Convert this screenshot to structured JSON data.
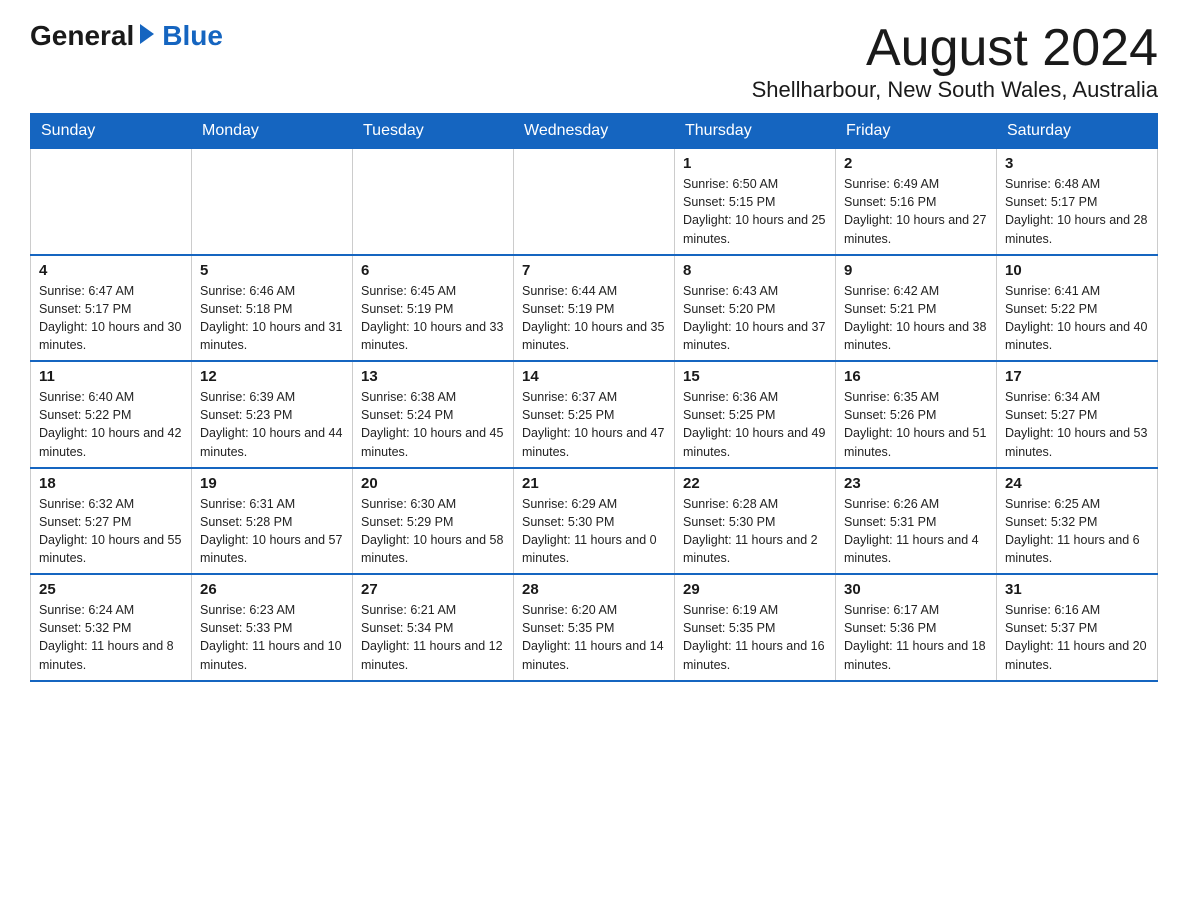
{
  "header": {
    "logo_general": "General",
    "logo_blue": "Blue",
    "month_year": "August 2024",
    "location": "Shellharbour, New South Wales, Australia"
  },
  "days_of_week": [
    "Sunday",
    "Monday",
    "Tuesday",
    "Wednesday",
    "Thursday",
    "Friday",
    "Saturday"
  ],
  "weeks": [
    [
      {
        "day": "",
        "info": ""
      },
      {
        "day": "",
        "info": ""
      },
      {
        "day": "",
        "info": ""
      },
      {
        "day": "",
        "info": ""
      },
      {
        "day": "1",
        "info": "Sunrise: 6:50 AM\nSunset: 5:15 PM\nDaylight: 10 hours and 25 minutes."
      },
      {
        "day": "2",
        "info": "Sunrise: 6:49 AM\nSunset: 5:16 PM\nDaylight: 10 hours and 27 minutes."
      },
      {
        "day": "3",
        "info": "Sunrise: 6:48 AM\nSunset: 5:17 PM\nDaylight: 10 hours and 28 minutes."
      }
    ],
    [
      {
        "day": "4",
        "info": "Sunrise: 6:47 AM\nSunset: 5:17 PM\nDaylight: 10 hours and 30 minutes."
      },
      {
        "day": "5",
        "info": "Sunrise: 6:46 AM\nSunset: 5:18 PM\nDaylight: 10 hours and 31 minutes."
      },
      {
        "day": "6",
        "info": "Sunrise: 6:45 AM\nSunset: 5:19 PM\nDaylight: 10 hours and 33 minutes."
      },
      {
        "day": "7",
        "info": "Sunrise: 6:44 AM\nSunset: 5:19 PM\nDaylight: 10 hours and 35 minutes."
      },
      {
        "day": "8",
        "info": "Sunrise: 6:43 AM\nSunset: 5:20 PM\nDaylight: 10 hours and 37 minutes."
      },
      {
        "day": "9",
        "info": "Sunrise: 6:42 AM\nSunset: 5:21 PM\nDaylight: 10 hours and 38 minutes."
      },
      {
        "day": "10",
        "info": "Sunrise: 6:41 AM\nSunset: 5:22 PM\nDaylight: 10 hours and 40 minutes."
      }
    ],
    [
      {
        "day": "11",
        "info": "Sunrise: 6:40 AM\nSunset: 5:22 PM\nDaylight: 10 hours and 42 minutes."
      },
      {
        "day": "12",
        "info": "Sunrise: 6:39 AM\nSunset: 5:23 PM\nDaylight: 10 hours and 44 minutes."
      },
      {
        "day": "13",
        "info": "Sunrise: 6:38 AM\nSunset: 5:24 PM\nDaylight: 10 hours and 45 minutes."
      },
      {
        "day": "14",
        "info": "Sunrise: 6:37 AM\nSunset: 5:25 PM\nDaylight: 10 hours and 47 minutes."
      },
      {
        "day": "15",
        "info": "Sunrise: 6:36 AM\nSunset: 5:25 PM\nDaylight: 10 hours and 49 minutes."
      },
      {
        "day": "16",
        "info": "Sunrise: 6:35 AM\nSunset: 5:26 PM\nDaylight: 10 hours and 51 minutes."
      },
      {
        "day": "17",
        "info": "Sunrise: 6:34 AM\nSunset: 5:27 PM\nDaylight: 10 hours and 53 minutes."
      }
    ],
    [
      {
        "day": "18",
        "info": "Sunrise: 6:32 AM\nSunset: 5:27 PM\nDaylight: 10 hours and 55 minutes."
      },
      {
        "day": "19",
        "info": "Sunrise: 6:31 AM\nSunset: 5:28 PM\nDaylight: 10 hours and 57 minutes."
      },
      {
        "day": "20",
        "info": "Sunrise: 6:30 AM\nSunset: 5:29 PM\nDaylight: 10 hours and 58 minutes."
      },
      {
        "day": "21",
        "info": "Sunrise: 6:29 AM\nSunset: 5:30 PM\nDaylight: 11 hours and 0 minutes."
      },
      {
        "day": "22",
        "info": "Sunrise: 6:28 AM\nSunset: 5:30 PM\nDaylight: 11 hours and 2 minutes."
      },
      {
        "day": "23",
        "info": "Sunrise: 6:26 AM\nSunset: 5:31 PM\nDaylight: 11 hours and 4 minutes."
      },
      {
        "day": "24",
        "info": "Sunrise: 6:25 AM\nSunset: 5:32 PM\nDaylight: 11 hours and 6 minutes."
      }
    ],
    [
      {
        "day": "25",
        "info": "Sunrise: 6:24 AM\nSunset: 5:32 PM\nDaylight: 11 hours and 8 minutes."
      },
      {
        "day": "26",
        "info": "Sunrise: 6:23 AM\nSunset: 5:33 PM\nDaylight: 11 hours and 10 minutes."
      },
      {
        "day": "27",
        "info": "Sunrise: 6:21 AM\nSunset: 5:34 PM\nDaylight: 11 hours and 12 minutes."
      },
      {
        "day": "28",
        "info": "Sunrise: 6:20 AM\nSunset: 5:35 PM\nDaylight: 11 hours and 14 minutes."
      },
      {
        "day": "29",
        "info": "Sunrise: 6:19 AM\nSunset: 5:35 PM\nDaylight: 11 hours and 16 minutes."
      },
      {
        "day": "30",
        "info": "Sunrise: 6:17 AM\nSunset: 5:36 PM\nDaylight: 11 hours and 18 minutes."
      },
      {
        "day": "31",
        "info": "Sunrise: 6:16 AM\nSunset: 5:37 PM\nDaylight: 11 hours and 20 minutes."
      }
    ]
  ]
}
